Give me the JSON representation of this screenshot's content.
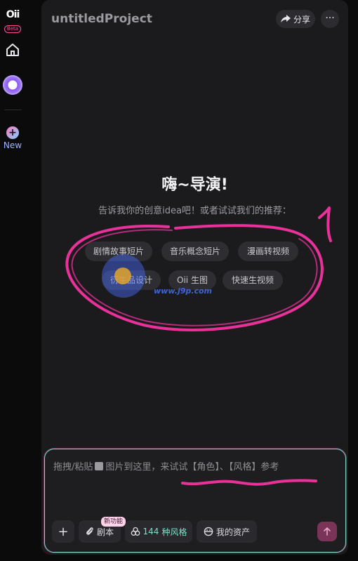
{
  "sidebar": {
    "logo_text": "Oii",
    "logo_badge": "Beta",
    "new_label": "New",
    "icons": [
      "home-icon",
      "avatar",
      "plus-icon"
    ]
  },
  "header": {
    "title": "untitledProject",
    "share_label": "分享",
    "more_label": "···"
  },
  "greeting": {
    "title": "嗨~导演!",
    "subtitle": "告诉我你的创意idea吧！或者试试我们的推荐："
  },
  "suggestions": [
    "剧情故事短片",
    "音乐概念短片",
    "漫画转视频",
    "衍生品设计",
    "Oii 生图",
    "快速生视频"
  ],
  "composer": {
    "placeholder_before": "拖拽/粘贴",
    "placeholder_after": "图片到这里，来试试【角色】、【风格】参考",
    "plus_label": "+",
    "script_label": "剧本",
    "new_feature_badge": "新功能",
    "styles_count": "144",
    "styles_label": "种风格",
    "assets_label": "我的资产"
  },
  "annotation": {
    "mark": "1"
  },
  "watermark": {
    "url": "www.j9p.com"
  },
  "colors": {
    "accent_pink": "#e8329a",
    "composer_border": "#7fd6c9",
    "send_button": "#7a3457",
    "new_label": "#9fb0ff"
  }
}
